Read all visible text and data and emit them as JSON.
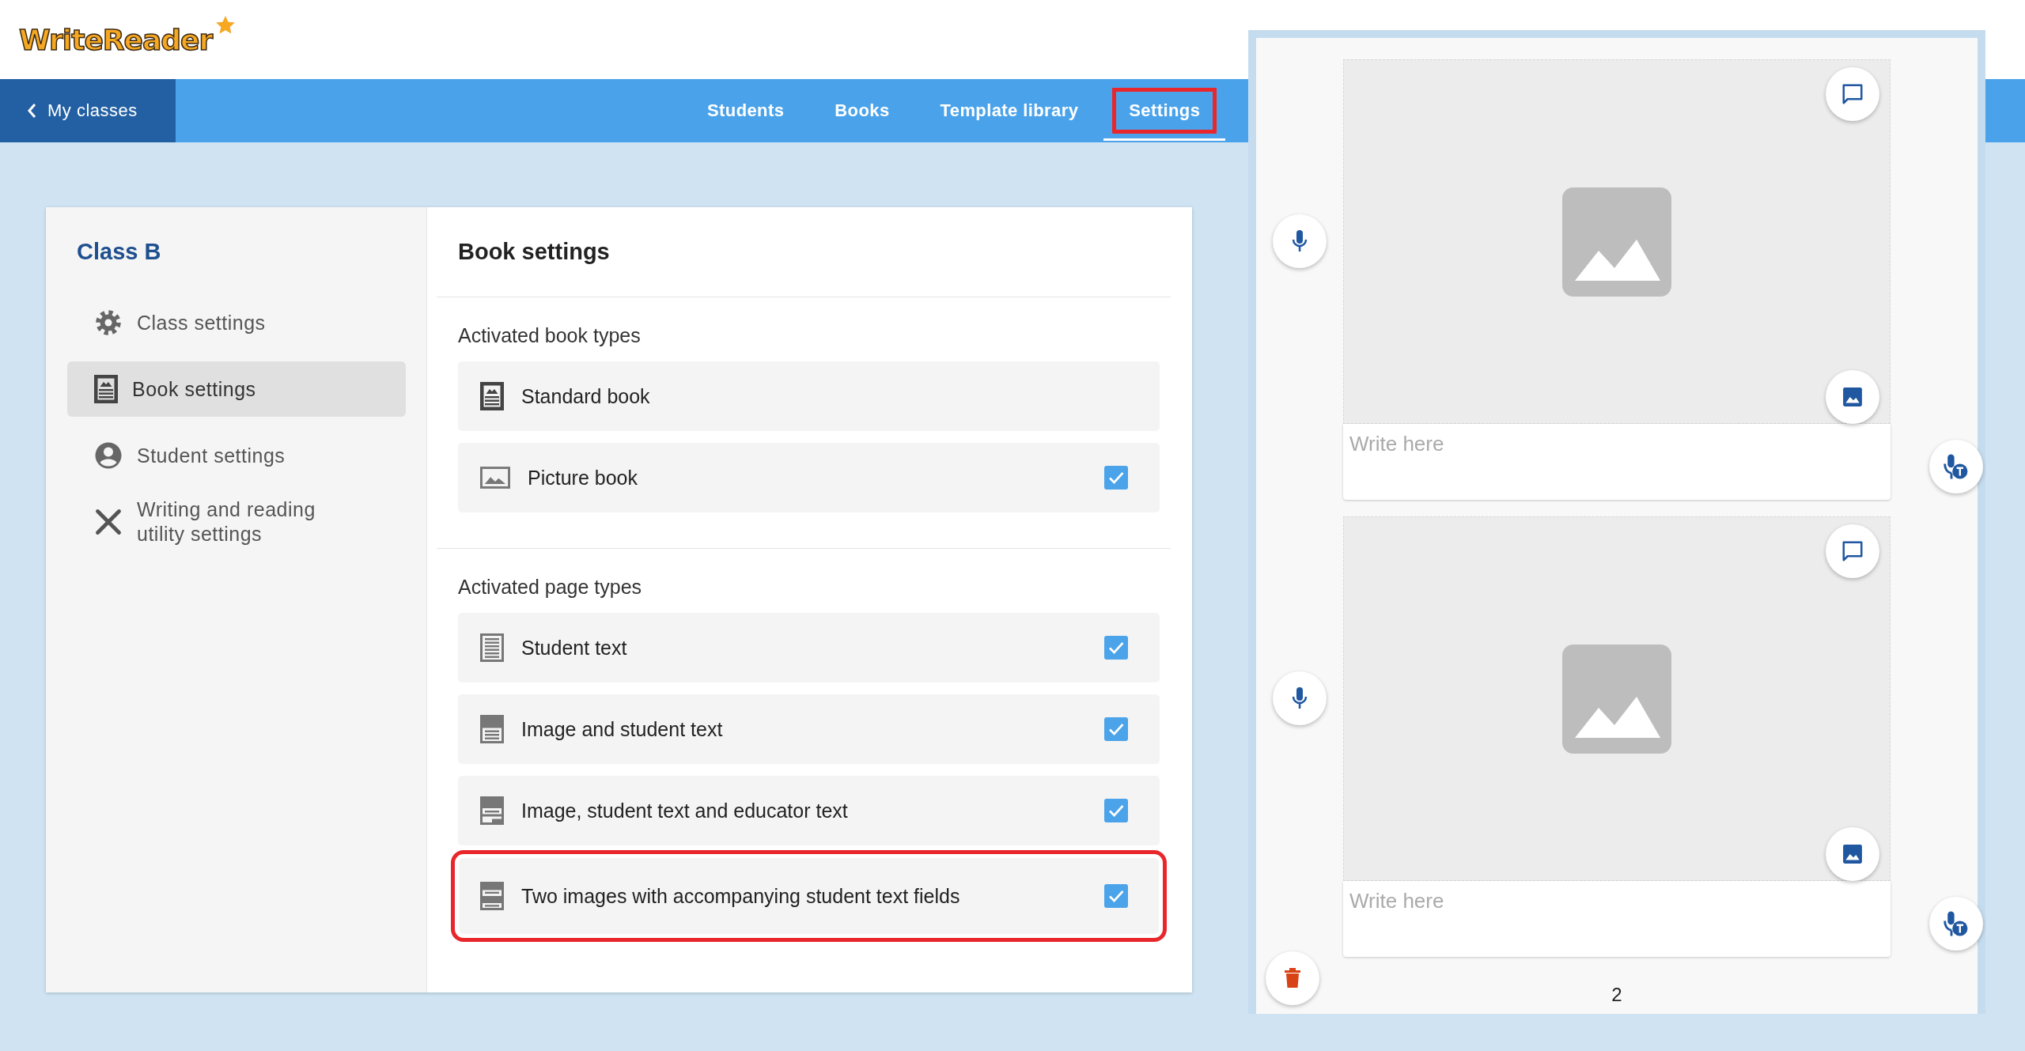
{
  "logo": {
    "text": "WriteReader"
  },
  "nav": {
    "back": "My classes",
    "tabs": [
      {
        "label": "Students",
        "selected": false,
        "highlighted": false
      },
      {
        "label": "Books",
        "selected": false,
        "highlighted": false
      },
      {
        "label": "Template library",
        "selected": false,
        "highlighted": false
      },
      {
        "label": "Settings",
        "selected": true,
        "highlighted": true
      }
    ]
  },
  "sidebar": {
    "title": "Class B",
    "items": [
      {
        "label": "Class settings",
        "selected": false
      },
      {
        "label": "Book settings",
        "selected": true
      },
      {
        "label": "Student settings",
        "selected": false
      },
      {
        "label": "Writing and reading utility settings",
        "selected": false
      }
    ]
  },
  "content": {
    "title": "Book settings",
    "sections": [
      {
        "heading": "Activated book types",
        "options": [
          {
            "label": "Standard book",
            "checked": false,
            "highlighted": false
          },
          {
            "label": "Picture book",
            "checked": true,
            "highlighted": false
          }
        ]
      },
      {
        "heading": "Activated page types",
        "options": [
          {
            "label": "Student text",
            "checked": true,
            "highlighted": false
          },
          {
            "label": "Image and student text",
            "checked": true,
            "highlighted": false
          },
          {
            "label": "Image, student text and educator text",
            "checked": true,
            "highlighted": false
          },
          {
            "label": "Two images with accompanying student text fields",
            "checked": true,
            "highlighted": true
          }
        ]
      }
    ]
  },
  "preview": {
    "pages": [
      {
        "placeholder": "Write here"
      },
      {
        "placeholder": "Write here"
      }
    ],
    "page_number": "2"
  }
}
